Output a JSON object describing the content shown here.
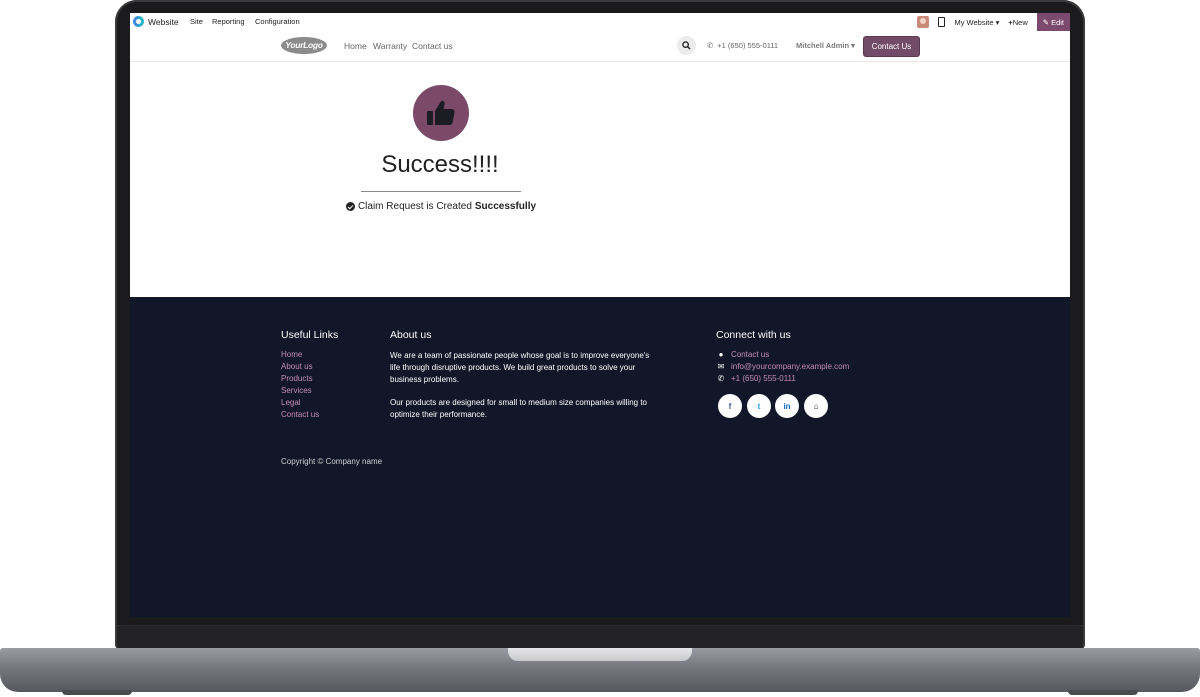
{
  "admin_bar": {
    "app_name": "Website",
    "menus": [
      "Site",
      "Reporting",
      "Configuration"
    ],
    "website_selector": "My Website",
    "new_label": "New",
    "edit_label": "Edit"
  },
  "site_header": {
    "logo_text": "YourLogo",
    "nav": [
      "Home",
      "Warranty",
      "Contact us"
    ],
    "phone": "+1 (650) 555-0111",
    "user": "Mitchell Admin",
    "cta_label": "Contact Us"
  },
  "content": {
    "icon": "thumbs-up-icon",
    "title": "Success!!!!",
    "message_prefix": "Claim Request is Created",
    "message_bold": "Successfully"
  },
  "footer": {
    "useful_links_title": "Useful Links",
    "useful_links": [
      "Home",
      "About us",
      "Products",
      "Services",
      "Legal",
      "Contact us"
    ],
    "about_title": "About us",
    "about_p1_lines": [
      "We are a team of passionate people whose goal is to improve everyone's",
      "life through disruptive products. We build great products to solve your",
      "business problems."
    ],
    "about_p2_lines": [
      "Our products are designed for small to medium size companies willing to",
      "optimize their performance."
    ],
    "connect_title": "Connect with us",
    "contact_link": "Contact us",
    "email": "info@yourcompany.example.com",
    "phone": "+1 (650) 555-0111",
    "social": [
      "facebook-icon",
      "twitter-icon",
      "linkedin-icon",
      "home-icon"
    ],
    "social_labels": [
      "f",
      "t",
      "in",
      "⌂"
    ],
    "copyright": "Copyright © Company name"
  },
  "colors": {
    "brand": "#714b67",
    "footer_bg": "#111628",
    "link": "#c68bb5"
  }
}
